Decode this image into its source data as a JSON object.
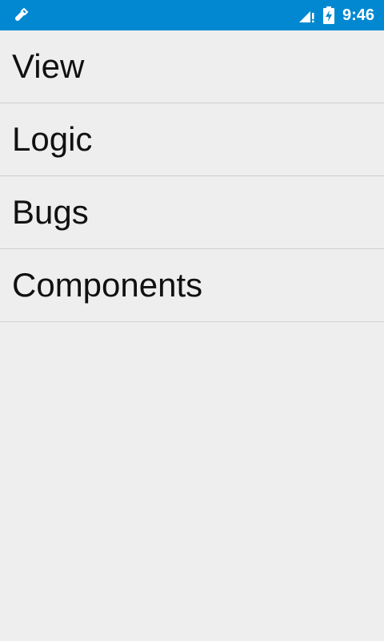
{
  "status_bar": {
    "time": "9:46",
    "left_icon": "usb-debug-icon",
    "signal_icon": "signal-no-data-icon",
    "battery_icon": "battery-charging-icon",
    "background_color": "#0288d1"
  },
  "menu": {
    "items": [
      {
        "label": "View"
      },
      {
        "label": "Logic"
      },
      {
        "label": "Bugs"
      },
      {
        "label": "Components"
      }
    ]
  },
  "colors": {
    "background": "#eeeeee",
    "divider": "#cfcfcf",
    "text": "#111111"
  }
}
